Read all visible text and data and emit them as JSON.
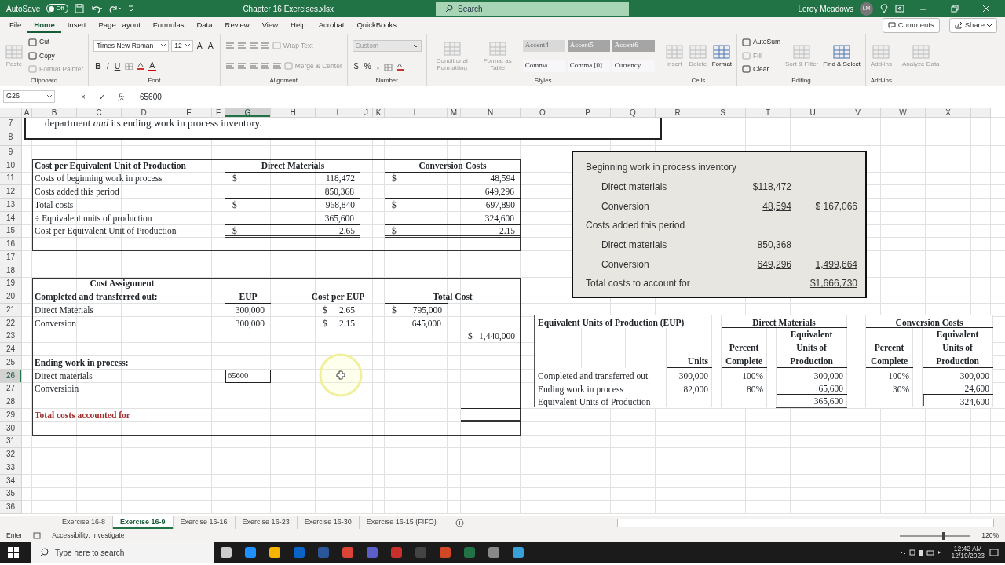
{
  "title_bar": {
    "autosave_label": "AutoSave",
    "autosave_on": false,
    "autosave_state": "Off",
    "file_name": "Chapter 16 Exercises.xlsx",
    "search_placeholder": "Search",
    "user_name": "Leroy Meadows",
    "user_initials": "LM"
  },
  "menu_tabs": [
    {
      "label": "File",
      "selected": false
    },
    {
      "label": "Home",
      "selected": true
    },
    {
      "label": "Insert",
      "selected": false
    },
    {
      "label": "Page Layout",
      "selected": false
    },
    {
      "label": "Formulas",
      "selected": false
    },
    {
      "label": "Data",
      "selected": false
    },
    {
      "label": "Review",
      "selected": false
    },
    {
      "label": "View",
      "selected": false
    },
    {
      "label": "Help",
      "selected": false
    },
    {
      "label": "Acrobat",
      "selected": false
    },
    {
      "label": "QuickBooks",
      "selected": false
    }
  ],
  "header_buttons": {
    "comments": "Comments",
    "share": "Share"
  },
  "ribbon": [
    {
      "label": "Clipboard",
      "columns": [
        [
          [
            {
              "kind": "large",
              "label": "Paste",
              "disabled": true
            }
          ]
        ],
        [
          [
            {
              "kind": "small",
              "label": "Cut",
              "disabled": false
            }
          ],
          [
            {
              "kind": "small",
              "label": "Copy",
              "disabled": false
            }
          ],
          [
            {
              "kind": "small",
              "label": "Format Painter",
              "disabled": true
            }
          ]
        ]
      ]
    },
    {
      "label": "Font",
      "columns": [
        [
          [
            {
              "kind": "field",
              "label": "Times New Roman",
              "disabled": false
            },
            {
              "kind": "field",
              "label": "12",
              "disabled": false
            },
            {
              "kind": "glyph",
              "label": "A",
              "disabled": false
            },
            {
              "kind": "glyph",
              "label": "A",
              "disabled": false
            }
          ],
          [
            {
              "kind": "glyph",
              "label": "B",
              "disabled": false
            },
            {
              "kind": "glyph",
              "label": "I",
              "disabled": false
            },
            {
              "kind": "glyph",
              "label": "U",
              "disabled": false
            },
            {
              "kind": "icon"
            },
            {
              "kind": "icon"
            },
            {
              "kind": "glyph",
              "label": "A",
              "disabled": false
            }
          ]
        ]
      ]
    },
    {
      "label": "Alignment",
      "columns": [
        [
          [
            {
              "kind": "icon"
            },
            {
              "kind": "icon"
            },
            {
              "kind": "icon"
            },
            {
              "kind": "icon"
            },
            {
              "kind": "small",
              "label": "Wrap Text",
              "disabled": true
            }
          ],
          [
            {
              "kind": "icon"
            },
            {
              "kind": "icon"
            },
            {
              "kind": "icon"
            },
            {
              "kind": "icon"
            },
            {
              "kind": "icon"
            },
            {
              "kind": "small",
              "label": "Merge & Center",
              "disabled": true
            }
          ]
        ]
      ]
    },
    {
      "label": "Number",
      "columns": [
        [
          [
            {
              "kind": "field",
              "label": "Custom",
              "disabled": true
            }
          ],
          [
            {
              "kind": "glyph",
              "label": "$",
              "disabled": false
            },
            {
              "kind": "glyph",
              "label": "%",
              "disabled": false
            },
            {
              "kind": "glyph",
              "label": ",",
              "disabled": false
            },
            {
              "kind": "icon"
            },
            {
              "kind": "icon"
            }
          ]
        ]
      ]
    },
    {
      "label": "Styles",
      "columns": [
        [
          [
            {
              "kind": "large",
              "label": "Conditional Formatting",
              "disabled": true
            }
          ]
        ],
        [
          [
            {
              "kind": "large",
              "label": "Format as Table",
              "disabled": true
            }
          ]
        ],
        [
          [
            {
              "kind": "accent",
              "label": "Accent4",
              "disabled": true
            },
            {
              "kind": "accent",
              "label": "Accent5",
              "disabled": false
            },
            {
              "kind": "accent",
              "label": "Accent6",
              "disabled": false
            }
          ],
          [
            {
              "kind": "style",
              "label": "Comma",
              "disabled": false
            },
            {
              "kind": "style",
              "label": "Comma [0]",
              "disabled": false
            },
            {
              "kind": "style",
              "label": "Currency",
              "disabled": false
            }
          ]
        ]
      ]
    },
    {
      "label": "Cells",
      "columns": [
        [
          [
            {
              "kind": "large",
              "label": "Insert",
              "disabled": true
            }
          ]
        ],
        [
          [
            {
              "kind": "large",
              "label": "Delete",
              "disabled": true
            }
          ]
        ],
        [
          [
            {
              "kind": "large",
              "label": "Format",
              "disabled": false
            }
          ]
        ]
      ]
    },
    {
      "label": "Editing",
      "columns": [
        [
          [
            {
              "kind": "small",
              "label": "AutoSum",
              "disabled": false
            }
          ],
          [
            {
              "kind": "small",
              "label": "Fill",
              "disabled": true
            }
          ],
          [
            {
              "kind": "small",
              "label": "Clear",
              "disabled": false
            }
          ]
        ],
        [
          [
            {
              "kind": "large",
              "label": "Sort & Filter",
              "disabled": true
            }
          ]
        ],
        [
          [
            {
              "kind": "large",
              "label": "Find & Select",
              "disabled": false
            }
          ]
        ]
      ]
    },
    {
      "label": "Add-ins",
      "columns": [
        [
          [
            {
              "kind": "large",
              "label": "Add-ins",
              "disabled": true
            }
          ]
        ]
      ]
    },
    {
      "columns": [
        [
          [
            {
              "kind": "large",
              "label": "Analyze Data",
              "disabled": true
            }
          ]
        ]
      ]
    }
  ],
  "formula_bar": {
    "name_box": "G26",
    "cancel": "×",
    "enter": "✓",
    "function": "fx",
    "formula": "65600"
  },
  "columns": [
    {
      "label": "A",
      "selected": false
    },
    {
      "label": "B",
      "selected": false
    },
    {
      "label": "C",
      "selected": false
    },
    {
      "label": "D",
      "selected": false
    },
    {
      "label": "E",
      "selected": false
    },
    {
      "label": "F",
      "selected": false
    },
    {
      "label": "G",
      "selected": true
    },
    {
      "label": "H",
      "selected": false
    },
    {
      "label": "I",
      "selected": false
    },
    {
      "label": "J",
      "selected": false
    },
    {
      "label": "K",
      "selected": false
    },
    {
      "label": "L",
      "selected": false
    },
    {
      "label": "M",
      "selected": false
    },
    {
      "label": "N",
      "selected": false
    },
    {
      "label": "O",
      "selected": false
    },
    {
      "label": "P",
      "selected": false
    },
    {
      "label": "Q",
      "selected": false
    },
    {
      "label": "R",
      "selected": false
    },
    {
      "label": "S",
      "selected": false
    },
    {
      "label": "T",
      "selected": false
    },
    {
      "label": "U",
      "selected": false
    },
    {
      "label": "V",
      "selected": false
    },
    {
      "label": "W",
      "selected": false
    },
    {
      "label": "X",
      "selected": false
    }
  ],
  "rows": [
    {
      "label": "7",
      "selected": false
    },
    {
      "label": "8",
      "selected": false
    },
    {
      "label": "9",
      "selected": false
    },
    {
      "label": "10",
      "selected": false
    },
    {
      "label": "11",
      "selected": false
    },
    {
      "label": "12",
      "selected": false
    },
    {
      "label": "13",
      "selected": false
    },
    {
      "label": "14",
      "selected": false
    },
    {
      "label": "15",
      "selected": false
    },
    {
      "label": "16",
      "selected": false
    },
    {
      "label": "17",
      "selected": false
    },
    {
      "label": "18",
      "selected": false
    },
    {
      "label": "19",
      "selected": false
    },
    {
      "label": "20",
      "selected": false
    },
    {
      "label": "21",
      "selected": false
    },
    {
      "label": "22",
      "selected": false
    },
    {
      "label": "23",
      "selected": false
    },
    {
      "label": "24",
      "selected": false
    },
    {
      "label": "25",
      "selected": false
    },
    {
      "label": "26",
      "selected": true
    },
    {
      "label": "27",
      "selected": false
    },
    {
      "label": "28",
      "selected": false
    },
    {
      "label": "29",
      "selected": false
    },
    {
      "label": "30",
      "selected": false
    },
    {
      "label": "31",
      "selected": false
    },
    {
      "label": "32",
      "selected": false
    },
    {
      "label": "33",
      "selected": false
    },
    {
      "label": "34",
      "selected": false
    },
    {
      "label": "35",
      "selected": false
    },
    {
      "label": "36",
      "selected": false
    }
  ],
  "text_box": {
    "text": "department *and* its ending work in process inventory."
  },
  "cost_per_eup": {
    "title": "Cost per Equivalent Unit of Production",
    "columns": [
      "Direct Materials",
      "Conversion Costs"
    ],
    "rows": [
      {
        "label": "Costs of beginning work in process",
        "values": [
          {
            "sign": "$",
            "text": "118,472"
          },
          {
            "sign": "$",
            "text": "48,594"
          }
        ]
      },
      {
        "label": "Costs added this period",
        "values": [
          {
            "text": "850,368"
          },
          {
            "text": "649,296"
          }
        ]
      },
      {
        "label": "Total costs",
        "values": [
          {
            "sign": "$",
            "text": "968,840"
          },
          {
            "sign": "$",
            "text": "697,890"
          }
        ]
      },
      {
        "label": "÷ Equivalent units of production",
        "values": [
          {
            "text": "365,600"
          },
          {
            "text": "324,600"
          }
        ]
      },
      {
        "label": "Cost per Equivalent Unit of Production",
        "values": [
          {
            "sign": "$",
            "text": "2.65"
          },
          {
            "sign": "$",
            "text": "2.15"
          }
        ]
      }
    ]
  },
  "cost_assignment": {
    "title": "Cost Assignment",
    "section": "Completed and transferred out:",
    "columns": [
      "EUP",
      "Cost per EUP",
      "Total Cost"
    ],
    "rows": [
      {
        "label": "Direct Materials",
        "eup": "300,000",
        "cost_per_eup": {
          "sign": "$",
          "text": "2.65"
        },
        "total": {
          "sign": "$",
          "text": "795,000"
        }
      },
      {
        "label": "Conversion",
        "eup": "300,000",
        "cost_per_eup": {
          "sign": "$",
          "text": "2.15"
        },
        "total": {
          "text": "645,000"
        }
      }
    ],
    "subtotal": {
      "sign": "$",
      "text": "1,440,000"
    },
    "ending_section": "Ending work in process:",
    "ending_rows": [
      {
        "label": "Direct materials",
        "eup": "65600",
        "editing": true
      },
      {
        "label": "Conversioin"
      }
    ],
    "total_label": "Total costs accounted for"
  },
  "cost_summary": [
    {
      "label": "Beginning work in process inventory",
      "children": [
        {
          "label": "Direct materials",
          "amount": "$118,472"
        },
        {
          "label": "Conversion",
          "amount": "48,594",
          "amount_underlined": true,
          "total": "$ 167,066"
        }
      ]
    },
    {
      "label": "Costs added this period",
      "children": [
        {
          "label": "Direct materials",
          "amount": "850,368"
        },
        {
          "label": "Conversion",
          "amount": "649,296",
          "amount_underlined": true,
          "total": "1,499,664",
          "total_underlined": true
        }
      ]
    },
    {
      "label": "Total costs to account for",
      "total": "$1,666,730",
      "total_double_underlined": true
    }
  ],
  "eup_table": {
    "title": "Equivalent Units of Production (EUP)",
    "groups": [
      "Direct Materials",
      "Conversion Costs"
    ],
    "headers": {
      "units": "Units",
      "dm_percent": "Percent Complete",
      "dm_eup": "Equivalent Units of Production",
      "cc_percent": "Percent Complete",
      "cc_eup": "Equivalent Units of Production"
    },
    "rows": [
      {
        "label": "Completed and transferred out",
        "units": "300,000",
        "dm_percent": "100%",
        "dm_eup": "300,000",
        "cc_percent": "100%",
        "cc_eup": "300,000",
        "cc_eup_outlined": false
      },
      {
        "label": "Ending work in process",
        "units": "82,000",
        "dm_percent": "80%",
        "dm_eup": "65,600",
        "cc_percent": "30%",
        "cc_eup": "24,600",
        "cc_eup_outlined": false
      },
      {
        "label": "Equivalent Units of Production",
        "dm_eup": "365,600",
        "cc_eup": "324,600",
        "cc_eup_outlined": true
      }
    ]
  },
  "sheet_tabs": [
    {
      "label": "Exercise 16-8",
      "selected": false
    },
    {
      "label": "Exercise 16-9",
      "selected": true
    },
    {
      "label": "Exercise 16-16",
      "selected": false
    },
    {
      "label": "Exercise 16-23",
      "selected": false
    },
    {
      "label": "Exercise 16-30",
      "selected": false
    },
    {
      "label": "Exercise 16-15 (FIFO)",
      "selected": false
    }
  ],
  "status_bar": {
    "mode": "Enter",
    "accessibility": "Accessibility: Investigate",
    "zoom_slider": {
      "level": 0.6
    },
    "zoom": "120%"
  },
  "taskbar": {
    "search_placeholder": "Type here to search",
    "time": "12:42 AM",
    "date": "12/19/2023"
  }
}
